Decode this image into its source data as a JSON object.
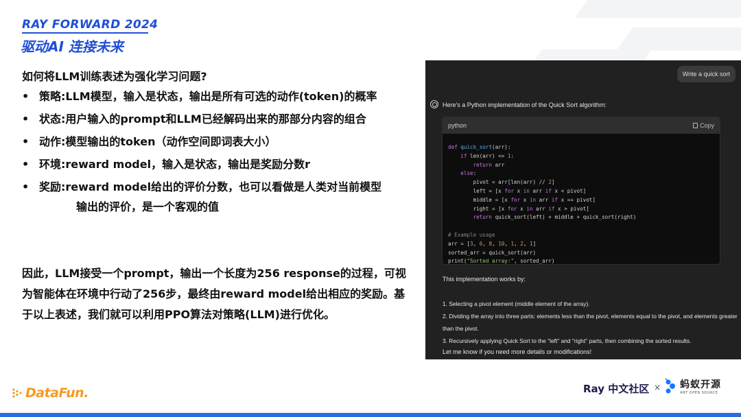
{
  "header": {
    "title": "RAY FORWARD 2024",
    "subtitle": "驱动AI 连接未来"
  },
  "content": {
    "question": "如何将LLM训练表述为强化学习问题?",
    "bullets": [
      {
        "label": "策略:",
        "text": "LLM模型，输入是状态，输出是所有可选的动作(token)的概率"
      },
      {
        "label": "状态:",
        "text": "用户输入的prompt和LLM已经解码出来的那部分内容的组合"
      },
      {
        "label": "动作:",
        "text": "模型输出的token（动作空间即词表大小）"
      },
      {
        "label": "环境:",
        "text": "reward model，输入是状态，输出是奖励分数r"
      },
      {
        "label": "奖励:",
        "text": "reward model给出的评价分数，也可以看做是人类对当前模型",
        "continuation": "输出的评价，是一个客观的值"
      }
    ],
    "bullet_marker": "•",
    "paragraph": "因此，LLM接受一个prompt，输出一个长度为256 response的过程，可视为智能体在环境中行动了256步，最终由reward model给出相应的奖励。基于以上表述，我们就可以利用PPO算法对策略(LLM)进行优化。"
  },
  "chat": {
    "user_message": "Write a quick sort",
    "intro": "Here's a Python implementation of the Quick Sort algorithm:",
    "code_lang": "python",
    "copy_label": "Copy",
    "works_heading": "This implementation works by:",
    "steps": [
      "1.  Selecting a pivot element (middle element of the array).",
      "2.  Dividing the array into three parts: elements less than the pivot, elements equal to the pivot, and elements greater than the pivot.",
      "3.  Recursively applying Quick Sort to the \"left\" and \"right\" parts, then combining the sorted results."
    ],
    "closing": "Let me know if you need more details or modifications!"
  },
  "footer": {
    "datafun": "DataFun.",
    "ray_community": "Ray 中文社区",
    "times": "×",
    "ant_cn": "蚂蚁开源",
    "ant_en": "ANT OPEN SOURCE"
  },
  "colors": {
    "brand_blue": "#1f4fd6",
    "datafun_orange": "#f59a23",
    "panel_bg": "#212121"
  }
}
